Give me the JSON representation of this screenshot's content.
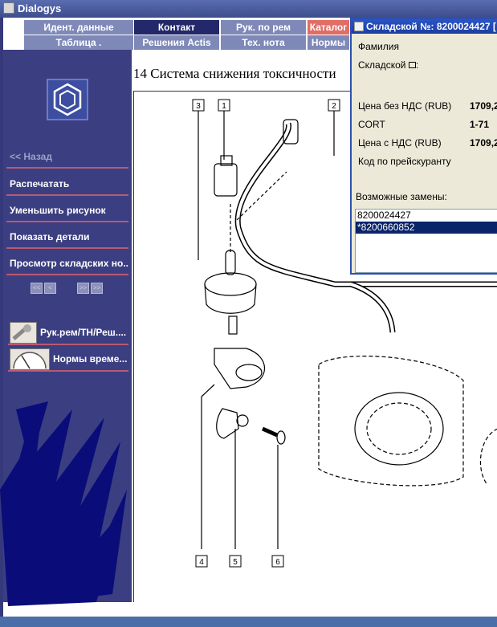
{
  "window": {
    "title": "Dialogys"
  },
  "tabs": {
    "row1": [
      {
        "label": "Идент. данные",
        "style": "light"
      },
      {
        "label": "Контакт",
        "style": "dark"
      },
      {
        "label": "Рук. по рем",
        "style": "light"
      },
      {
        "label": "Каталог",
        "style": "red"
      }
    ],
    "row2": [
      {
        "label": "Таблица .",
        "style": "light"
      },
      {
        "label": "Решения Actis",
        "style": "light"
      },
      {
        "label": "Тех. нота",
        "style": "light"
      },
      {
        "label": "Нормы",
        "style": "light"
      }
    ]
  },
  "page": {
    "title": "14 Система снижения токсичности"
  },
  "sidebar": {
    "back": "<< Назад",
    "items": [
      {
        "label": "Распечатать"
      },
      {
        "label": "Уменьшить рисунок"
      },
      {
        "label": "Показать детали"
      },
      {
        "label": "Просмотр складских но..."
      }
    ],
    "nav": {
      "first": "<<",
      "prev": "<",
      "next": ">>",
      "last": ">>"
    },
    "tools": [
      {
        "label": "Рук.рем/ТН/Реш...."
      },
      {
        "label": "Нормы време..."
      }
    ]
  },
  "popup": {
    "title": "Складской №: 8200024427 [",
    "fields": [
      {
        "label": "Фамилия",
        "value": ""
      },
      {
        "label": "Складской",
        "value": ""
      },
      {
        "label": "Цена без НДС (RUB)",
        "value": "1709,2"
      },
      {
        "label": "CORT",
        "value": "1-71"
      },
      {
        "label": "Цена с НДС (RUB)",
        "value": "1709,2"
      },
      {
        "label": "Код по прейскуранту",
        "value": ""
      }
    ],
    "replacements_label": "Возможные замены:",
    "replacements": [
      "8200024427",
      "*8200660852"
    ]
  },
  "drawing": {
    "callouts": [
      "1",
      "2",
      "3",
      "4",
      "5",
      "6"
    ]
  },
  "colors": {
    "frame": "#35387a",
    "tab_light": "#7f89b8",
    "tab_dark": "#23286a",
    "tab_active": "#e06d66",
    "popup_title": "#2a54c6",
    "list_selected": "#0a246a"
  }
}
